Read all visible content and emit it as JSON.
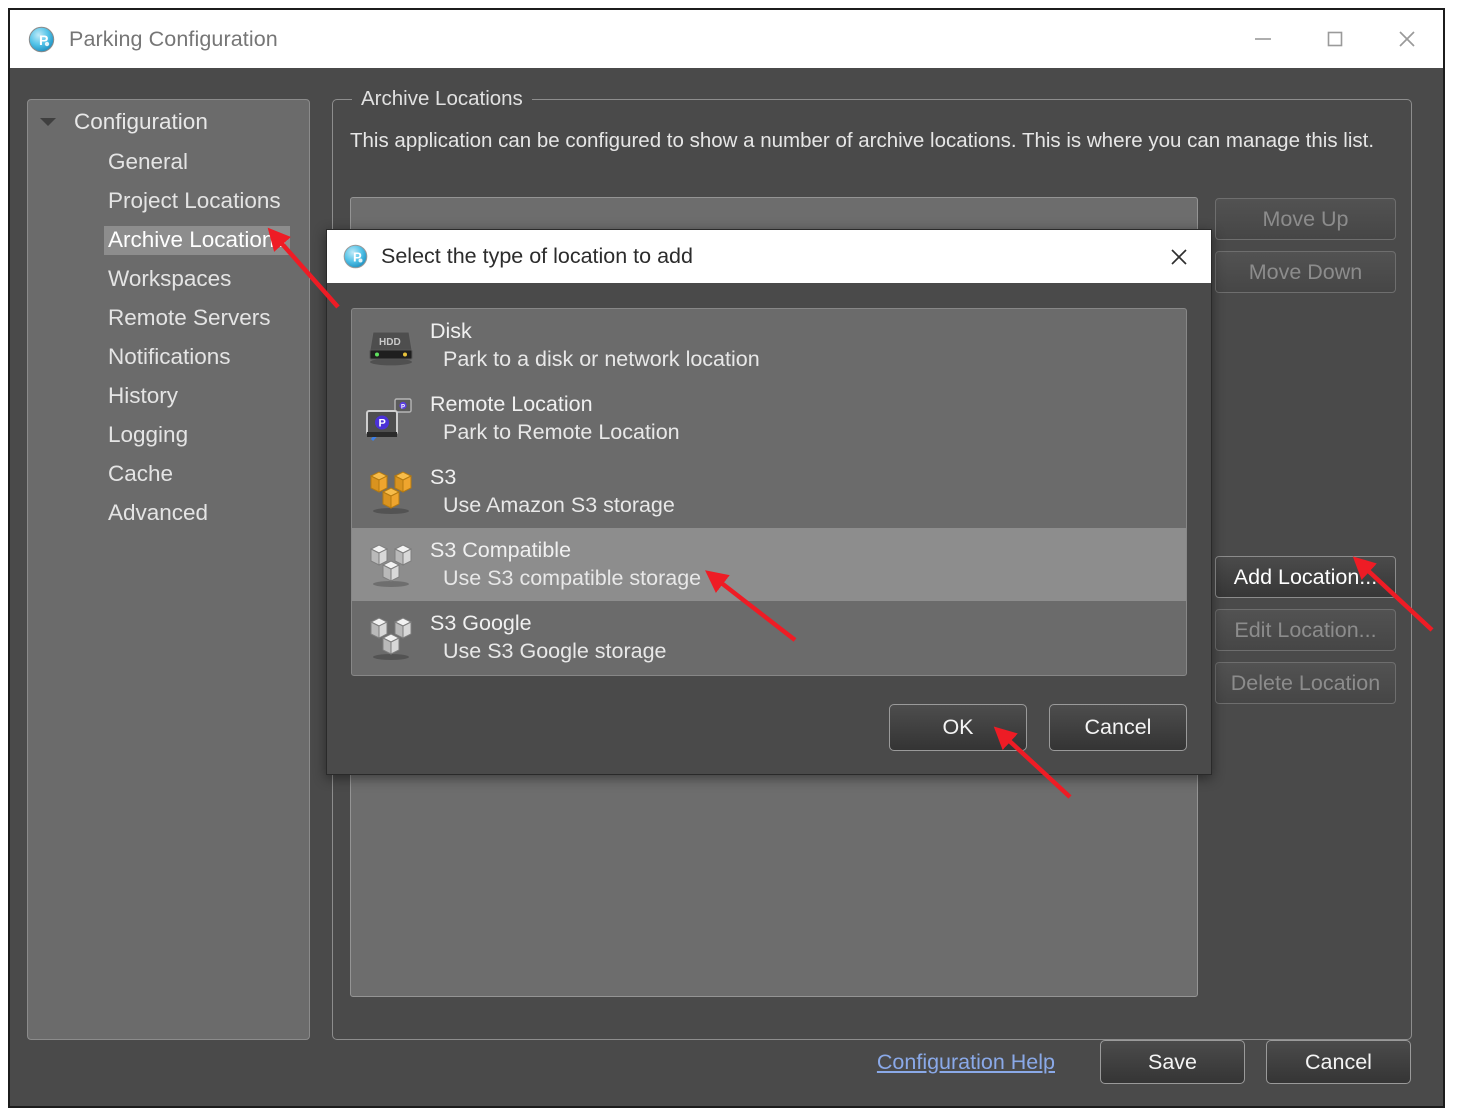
{
  "window": {
    "title": "Parking Configuration",
    "app_icon": "parking-logo-icon",
    "controls": {
      "minimize": "minimize-icon",
      "maximize": "maximize-icon",
      "close": "close-icon"
    }
  },
  "sidebar": {
    "root": {
      "label": "Configuration",
      "expanded": true
    },
    "items": [
      {
        "label": "General",
        "selected": false
      },
      {
        "label": "Project Locations",
        "selected": false
      },
      {
        "label": "Archive Locations",
        "selected": true
      },
      {
        "label": "Workspaces",
        "selected": false
      },
      {
        "label": "Remote Servers",
        "selected": false
      },
      {
        "label": "Notifications",
        "selected": false
      },
      {
        "label": "History",
        "selected": false
      },
      {
        "label": "Logging",
        "selected": false
      },
      {
        "label": "Cache",
        "selected": false
      },
      {
        "label": "Advanced",
        "selected": false
      }
    ]
  },
  "main": {
    "group_title": "Archive Locations",
    "description": "This application can be configured to show a number of archive locations. This is where you can manage this list.",
    "side_buttons": [
      {
        "label": "Move Up",
        "enabled": false
      },
      {
        "label": "Move Down",
        "enabled": false
      },
      {
        "label": "Add Location...",
        "enabled": true
      },
      {
        "label": "Edit Location...",
        "enabled": false
      },
      {
        "label": "Delete Location",
        "enabled": false
      }
    ],
    "locations": []
  },
  "bottom_bar": {
    "help_link": "Configuration Help",
    "save_label": "Save",
    "cancel_label": "Cancel"
  },
  "dialog": {
    "title": "Select the type of location to add",
    "app_icon": "parking-logo-icon",
    "close_icon": "close-icon",
    "options": [
      {
        "title": "Disk",
        "subtitle": "Park to a disk or network location",
        "icon": "hdd-icon",
        "selected": false
      },
      {
        "title": "Remote Location",
        "subtitle": "Park to Remote Location",
        "icon": "remote-location-icon",
        "selected": false
      },
      {
        "title": "S3",
        "subtitle": "Use Amazon S3 storage",
        "icon": "s3-orange-cubes-icon",
        "selected": false
      },
      {
        "title": "S3 Compatible",
        "subtitle": "Use S3 compatible storage",
        "icon": "s3-white-cubes-icon",
        "selected": true
      },
      {
        "title": "S3 Google",
        "subtitle": "Use S3 Google storage",
        "icon": "s3-white-cubes-icon",
        "selected": false
      }
    ],
    "ok_label": "OK",
    "cancel_label": "Cancel"
  },
  "colors": {
    "window_background": "#4a4a4a",
    "panel_background": "#6b6b6b",
    "selection": "#8d8d8d",
    "link": "#8aa9e8",
    "annotation_arrow": "#ee1c25",
    "titlebar": "#ffffff"
  },
  "annotations": {
    "arrows": [
      {
        "target": "Archive Locations",
        "points_to": "sidebar-item-archive-locations"
      },
      {
        "target": "S3 Compatible",
        "points_to": "dialog-option-s3-compatible"
      },
      {
        "target": "OK",
        "points_to": "dialog-ok-button"
      },
      {
        "target": "Add Location...",
        "points_to": "add-location-button"
      }
    ]
  }
}
